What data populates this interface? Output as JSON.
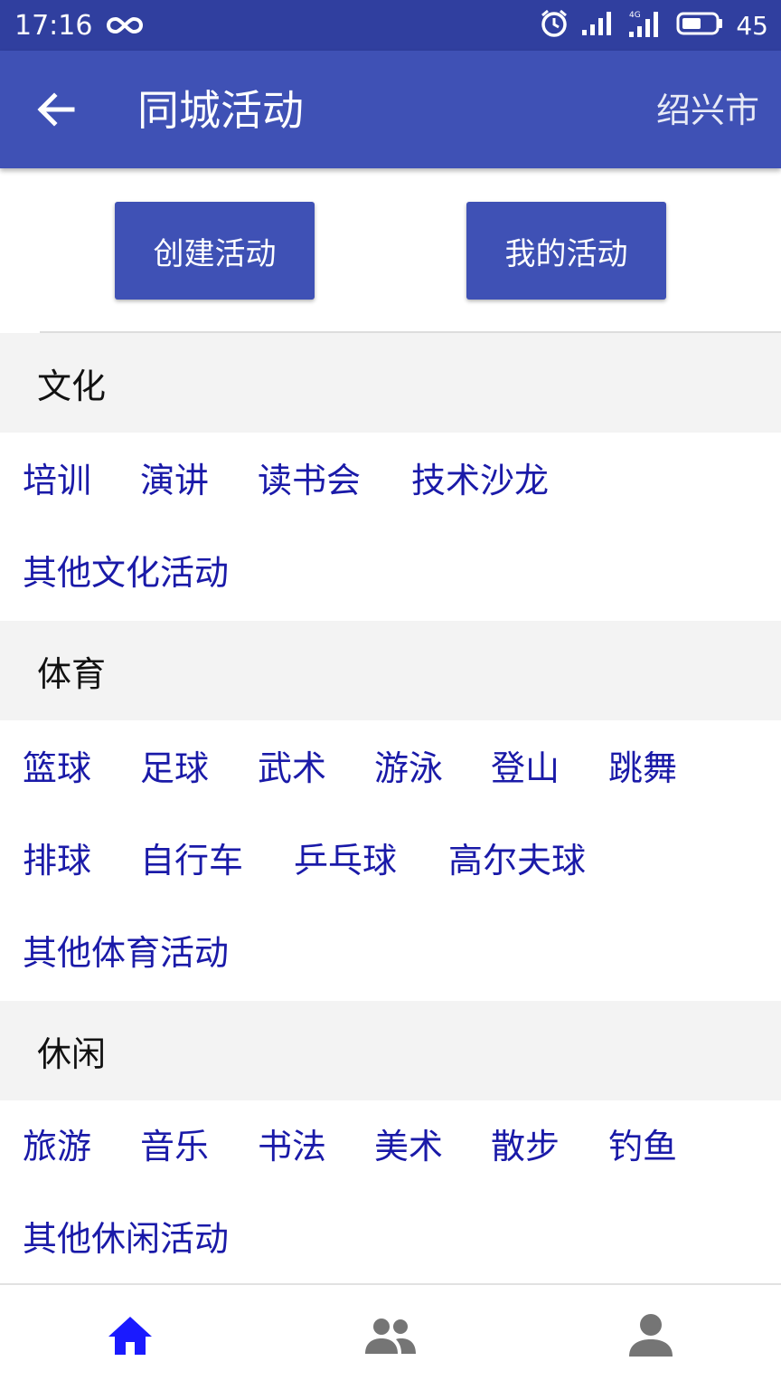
{
  "status_bar": {
    "time": "17:16",
    "battery": "45",
    "icons": [
      "infinity-icon",
      "alarm-icon",
      "signal-icon",
      "4g-signal-icon",
      "battery-icon"
    ]
  },
  "app_bar": {
    "title": "同城活动",
    "city": "绍兴市",
    "back_icon": "arrow-left-icon"
  },
  "actions": {
    "create": "创建活动",
    "mine": "我的活动"
  },
  "sections": [
    {
      "title": "文化",
      "tags": [
        [
          "培训",
          "演讲",
          "读书会",
          "技术沙龙"
        ],
        [
          "其他文化活动"
        ]
      ]
    },
    {
      "title": "体育",
      "tags": [
        [
          "篮球",
          "足球",
          "武术",
          "游泳",
          "登山",
          "跳舞"
        ],
        [
          "排球",
          "自行车",
          "乒乓球",
          "高尔夫球"
        ],
        [
          "其他体育活动"
        ]
      ]
    },
    {
      "title": "休闲",
      "tags": [
        [
          "旅游",
          "音乐",
          "书法",
          "美术",
          "散步",
          "钓鱼"
        ],
        [
          "其他休闲活动"
        ]
      ]
    }
  ],
  "bottom_nav": {
    "items": [
      "home-icon",
      "group-icon",
      "person-icon"
    ],
    "active_color": "#1a1aff",
    "inactive_color": "#757575"
  },
  "colors": {
    "status_bar": "#303f9f",
    "primary": "#3f51b5",
    "tag_text": "#1a1aa8",
    "section_bg": "#f3f3f3"
  }
}
